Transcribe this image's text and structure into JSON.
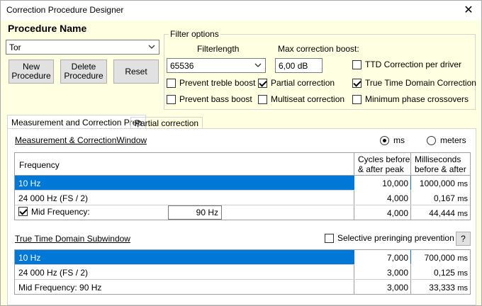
{
  "window": {
    "title": "Correction Procedure Designer",
    "close": "✕"
  },
  "procedure": {
    "heading": "Procedure Name",
    "name": "Tor",
    "buttons": {
      "new": "New Procedure",
      "delete": "Delete Procedure",
      "reset": "Reset"
    }
  },
  "filter": {
    "group_label": "Filter options",
    "filterlength_label": "Filterlength",
    "filterlength": "65536",
    "boost_label": "Max correction boost:",
    "boost": "6,00 dB",
    "options": {
      "prevent_treble": {
        "label": "Prevent treble boost",
        "checked": false
      },
      "prevent_bass": {
        "label": "Prevent bass boost",
        "checked": false
      },
      "partial": {
        "label": "Partial correction",
        "checked": true
      },
      "multiseat": {
        "label": "Multiseat correction",
        "checked": false
      },
      "ttd_per_driver": {
        "label": "TTD Correction per driver",
        "checked": false
      },
      "ttd": {
        "label": "True Time Domain Correction",
        "checked": true
      },
      "min_phase": {
        "label": "Minimum phase crossovers",
        "checked": false
      }
    }
  },
  "tabs": [
    "Measurement and Correction Prep",
    "Partial correction"
  ],
  "window_section": {
    "title": "Measurement & CorrectionWindow",
    "radio_ms": "ms",
    "radio_meters": "meters",
    "selected": "ms"
  },
  "table1": {
    "headers": {
      "frequency": "Frequency",
      "cycles": "Cycles before & after peak",
      "ms": "Milliseconds before & after"
    },
    "rows": [
      {
        "freq": "10 Hz",
        "cycles": "10,000",
        "ms": "1000,000",
        "unit": "ms"
      },
      {
        "freq": "24 000 Hz (FS / 2)",
        "cycles": "4,000",
        "ms": "0,167",
        "unit": "ms"
      },
      {
        "freq": "Mid Frequency:",
        "mid_value": "90 Hz",
        "checked": true,
        "cycles": "4,000",
        "ms": "44,444",
        "unit": "ms"
      }
    ]
  },
  "sub_section": {
    "title": "True Time Domain Subwindow",
    "selective": "Selective preringing prevention",
    "help": "?"
  },
  "table2": {
    "rows": [
      {
        "freq": "10 Hz",
        "cycles": "7,000",
        "ms": "700,000",
        "unit": "ms"
      },
      {
        "freq": "24 000 Hz (FS / 2)",
        "cycles": "3,000",
        "ms": "0,125",
        "unit": "ms"
      },
      {
        "freq": "Mid Frequency: 90 Hz",
        "cycles": "3,000",
        "ms": "33,333",
        "unit": "ms"
      }
    ]
  }
}
